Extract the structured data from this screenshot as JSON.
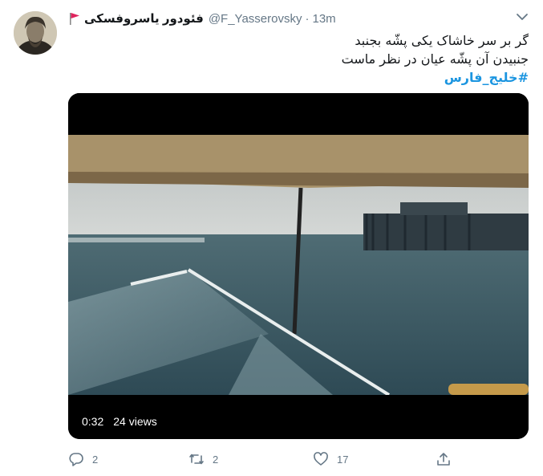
{
  "tweet": {
    "display_name": "فئودور یاسروفسکی",
    "handle": "@F_Yasserovsky",
    "separator": "·",
    "time": "13m",
    "lines": [
      "گر بر سر خاشاک یکی پشّه بجنبد",
      "جنبیدن آن پشّه عیان در نظر ماست"
    ],
    "hashtag": "#خلیج_فارس"
  },
  "video": {
    "duration": "0:32",
    "views": "24 views"
  },
  "actions": {
    "replies": "2",
    "retweets": "2",
    "likes": "17"
  },
  "icons": {
    "flag": "red-flag-icon",
    "caret": "chevron-down-icon",
    "reply": "reply-icon",
    "retweet": "retweet-icon",
    "like": "heart-icon",
    "share": "share-icon"
  },
  "colors": {
    "link": "#1b95e0",
    "muted": "#657786",
    "flag": "#e0245e"
  }
}
